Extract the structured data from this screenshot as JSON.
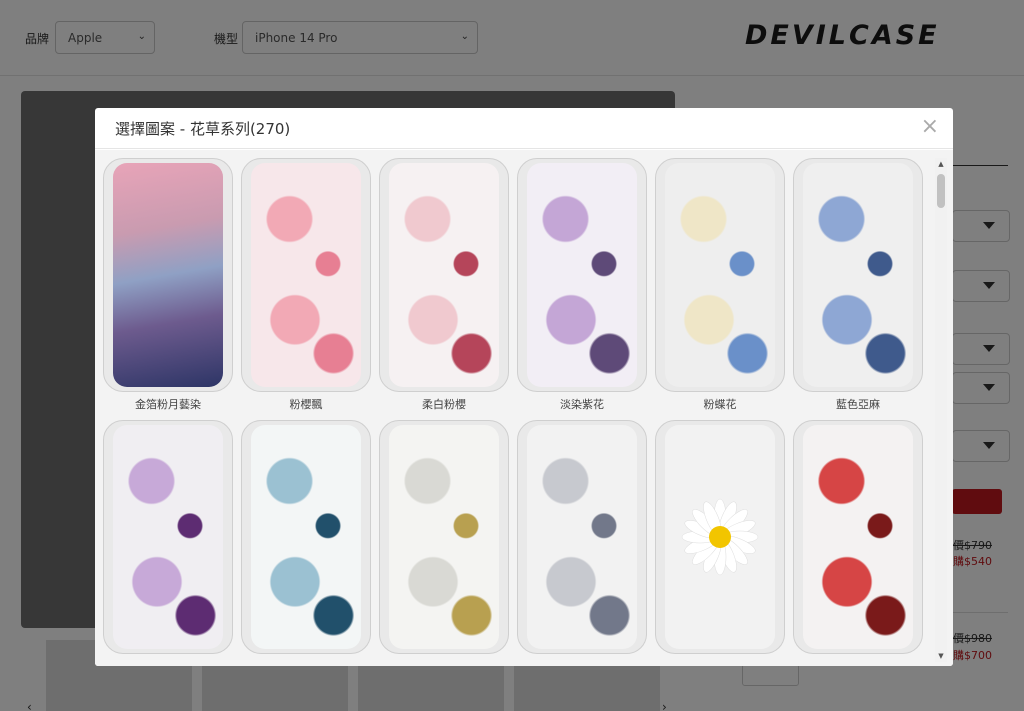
{
  "filters": {
    "brand_label": "品牌",
    "brand_value": "Apple",
    "model_label": "機型",
    "model_value": "iPhone 14 Pro"
  },
  "brand_logo": "DEVILCASE",
  "right_panel": {
    "prices": [
      {
        "original": "價$790",
        "sale": "購$540"
      },
      {
        "original": "價$980",
        "sale": "購$700"
      }
    ]
  },
  "modal": {
    "title": "選擇圖案 - 花草系列(270)",
    "close_icon": "×",
    "designs": [
      {
        "label": "金箔粉月藝染",
        "colors": [
          "#e8a4b8",
          "#6d5b8e",
          "#2d3566"
        ]
      },
      {
        "label": "粉櫻飄",
        "colors": [
          "#f7e7ea",
          "#f2a9b5",
          "#e77f93"
        ]
      },
      {
        "label": "柔白粉櫻",
        "colors": [
          "#f6f1f2",
          "#f0c9cf",
          "#b5455a"
        ]
      },
      {
        "label": "淡染紫花",
        "colors": [
          "#f2eef5",
          "#c4a6d6",
          "#5e4a78"
        ]
      },
      {
        "label": "粉蝶花",
        "colors": [
          "#eeeeee",
          "#efe6c7",
          "#6a90c9"
        ]
      },
      {
        "label": "藍色亞麻",
        "colors": [
          "#efefef",
          "#8ea7d4",
          "#3f5a8c"
        ]
      },
      {
        "label": "",
        "colors": [
          "#f0eef2",
          "#c7a9d8",
          "#5d2c72"
        ]
      },
      {
        "label": "",
        "colors": [
          "#f3f6f6",
          "#9bc1d2",
          "#21506b"
        ]
      },
      {
        "label": "",
        "colors": [
          "#f4f4f2",
          "#d9d9d4",
          "#b8a050"
        ]
      },
      {
        "label": "",
        "colors": [
          "#f2f2f2",
          "#c7c9cf",
          "#72788a"
        ]
      },
      {
        "label": "",
        "colors": [
          "#f2f2f2",
          "#ffffff",
          "#f2c500"
        ]
      },
      {
        "label": "",
        "colors": [
          "#f4f2f2",
          "#d64545",
          "#7a1a1a"
        ]
      }
    ]
  }
}
